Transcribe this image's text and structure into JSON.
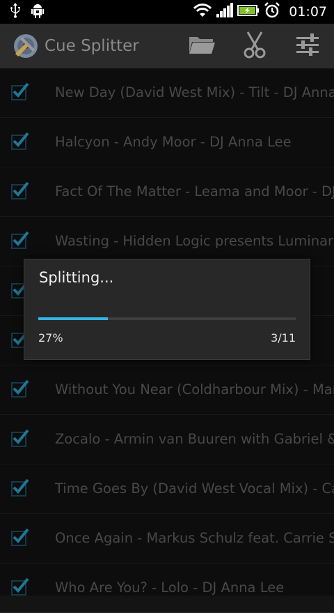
{
  "status_bar": {
    "time": "01:07",
    "left_icons": [
      "usb-icon",
      "android-debug-icon"
    ],
    "right_icons": [
      "wifi-icon",
      "signal-icon",
      "battery-charging-icon",
      "alarm-clock-icon"
    ]
  },
  "action_bar": {
    "title": "Cue Splitter",
    "actions": [
      "folder-icon",
      "scissors-icon",
      "settings-sliders-icon"
    ]
  },
  "tracks": [
    {
      "label": "New Day (David West Mix) - Tilt - DJ Anna Lee",
      "checked": true
    },
    {
      "label": "Halcyon - Andy Moor - DJ Anna Lee",
      "checked": true
    },
    {
      "label": "Fact Of The Matter - Leama and Moor - DJ Anna Lee",
      "checked": true
    },
    {
      "label": "Wasting - Hidden Logic presents Luminary",
      "checked": true
    },
    {
      "label": "",
      "checked": true
    },
    {
      "label": "",
      "checked": true
    },
    {
      "label": "Without You Near (Coldharbour Mix) - Markus Schulz",
      "checked": true
    },
    {
      "label": "Zocalo - Armin van Buuren with Gabriel & Dresden",
      "checked": true
    },
    {
      "label": "Time Goes By (David West Vocal Mix) - Carl B",
      "checked": true
    },
    {
      "label": "Once Again - Markus Schulz feat. Carrie Skipper",
      "checked": true
    },
    {
      "label": "Who Are You? - Lolo - DJ Anna Lee",
      "checked": true
    }
  ],
  "dialog": {
    "title": "Splitting...",
    "percent_label": "27%",
    "count_label": "3/11",
    "progress_fraction": 0.27
  },
  "colors": {
    "accent": "#33b5e5",
    "checkbox": "#33b5e5",
    "actionbar_bg": "#2b2b2b"
  }
}
